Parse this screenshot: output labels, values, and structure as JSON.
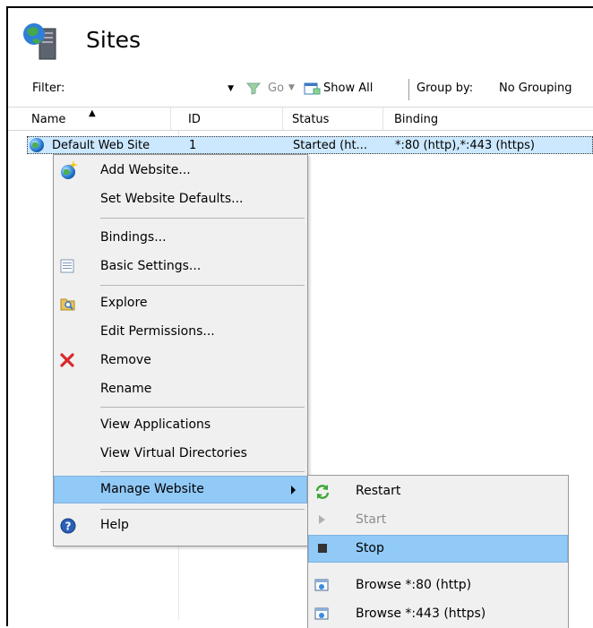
{
  "page": {
    "title": "Sites"
  },
  "filterbar": {
    "filter_label": "Filter:",
    "filter_value": "",
    "go_label": "Go",
    "show_all_label": "Show All",
    "group_by_label": "Group by:",
    "group_by_value": "No Grouping"
  },
  "grid": {
    "columns": [
      "Name",
      "ID",
      "Status",
      "Binding"
    ],
    "rows": [
      {
        "name": "Default Web Site",
        "id": "1",
        "status": "Started (ht...",
        "binding": "*:80 (http),*:443 (https)"
      }
    ]
  },
  "context_menu": {
    "items": [
      {
        "label": "Add Website...",
        "icon": "globe-add-icon"
      },
      {
        "label": "Set Website Defaults...",
        "icon": ""
      },
      {
        "label": "Bindings...",
        "icon": ""
      },
      {
        "label": "Basic Settings...",
        "icon": "settings-page-icon"
      },
      {
        "label": "Explore",
        "icon": "folder-search-icon"
      },
      {
        "label": "Edit Permissions...",
        "icon": ""
      },
      {
        "label": "Remove",
        "icon": "red-x-icon"
      },
      {
        "label": "Rename",
        "icon": ""
      },
      {
        "label": "View Applications",
        "icon": ""
      },
      {
        "label": "View Virtual Directories",
        "icon": ""
      },
      {
        "label": "Manage Website",
        "icon": ""
      },
      {
        "label": "Help",
        "icon": "help-icon"
      }
    ]
  },
  "submenu": {
    "items": [
      {
        "label": "Restart",
        "icon": "restart-icon",
        "enabled": true
      },
      {
        "label": "Start",
        "icon": "play-icon",
        "enabled": false
      },
      {
        "label": "Stop",
        "icon": "stop-icon",
        "enabled": true
      },
      {
        "label": "Browse *:80 (http)",
        "icon": "browse-icon",
        "enabled": true
      },
      {
        "label": "Browse *:443 (https)",
        "icon": "browse-icon",
        "enabled": true
      }
    ]
  },
  "colors": {
    "selection": "#cce8ff",
    "menu_highlight": "#91c9f7",
    "menu_bg": "#f0f0f0",
    "remove_red": "#d8282b"
  }
}
